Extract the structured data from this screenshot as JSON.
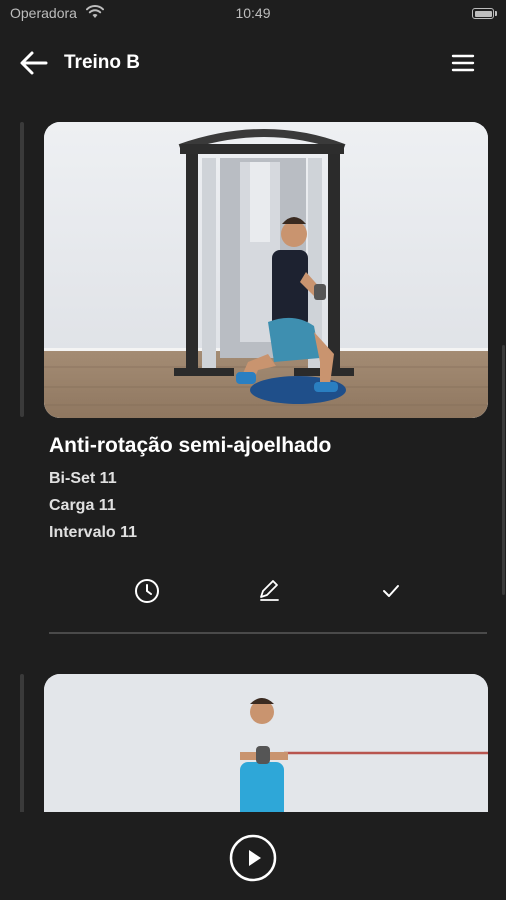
{
  "status_bar": {
    "carrier": "Operadora",
    "time": "10:49"
  },
  "header": {
    "title": "Treino B"
  },
  "exercises": [
    {
      "name": "Anti-rotação semi-ajoelhado",
      "details": [
        "Bi-Set 11",
        "Carga 11",
        "Intervalo 11"
      ]
    }
  ],
  "icons": {
    "back": "arrow-left-icon",
    "menu": "hamburger-menu-icon",
    "timer": "clock-icon",
    "edit": "pencil-icon",
    "done": "checkmark-icon",
    "play": "play-icon"
  },
  "colors": {
    "background": "#1e1e1e",
    "text": "#ffffff",
    "divider": "#4a4a4a"
  }
}
